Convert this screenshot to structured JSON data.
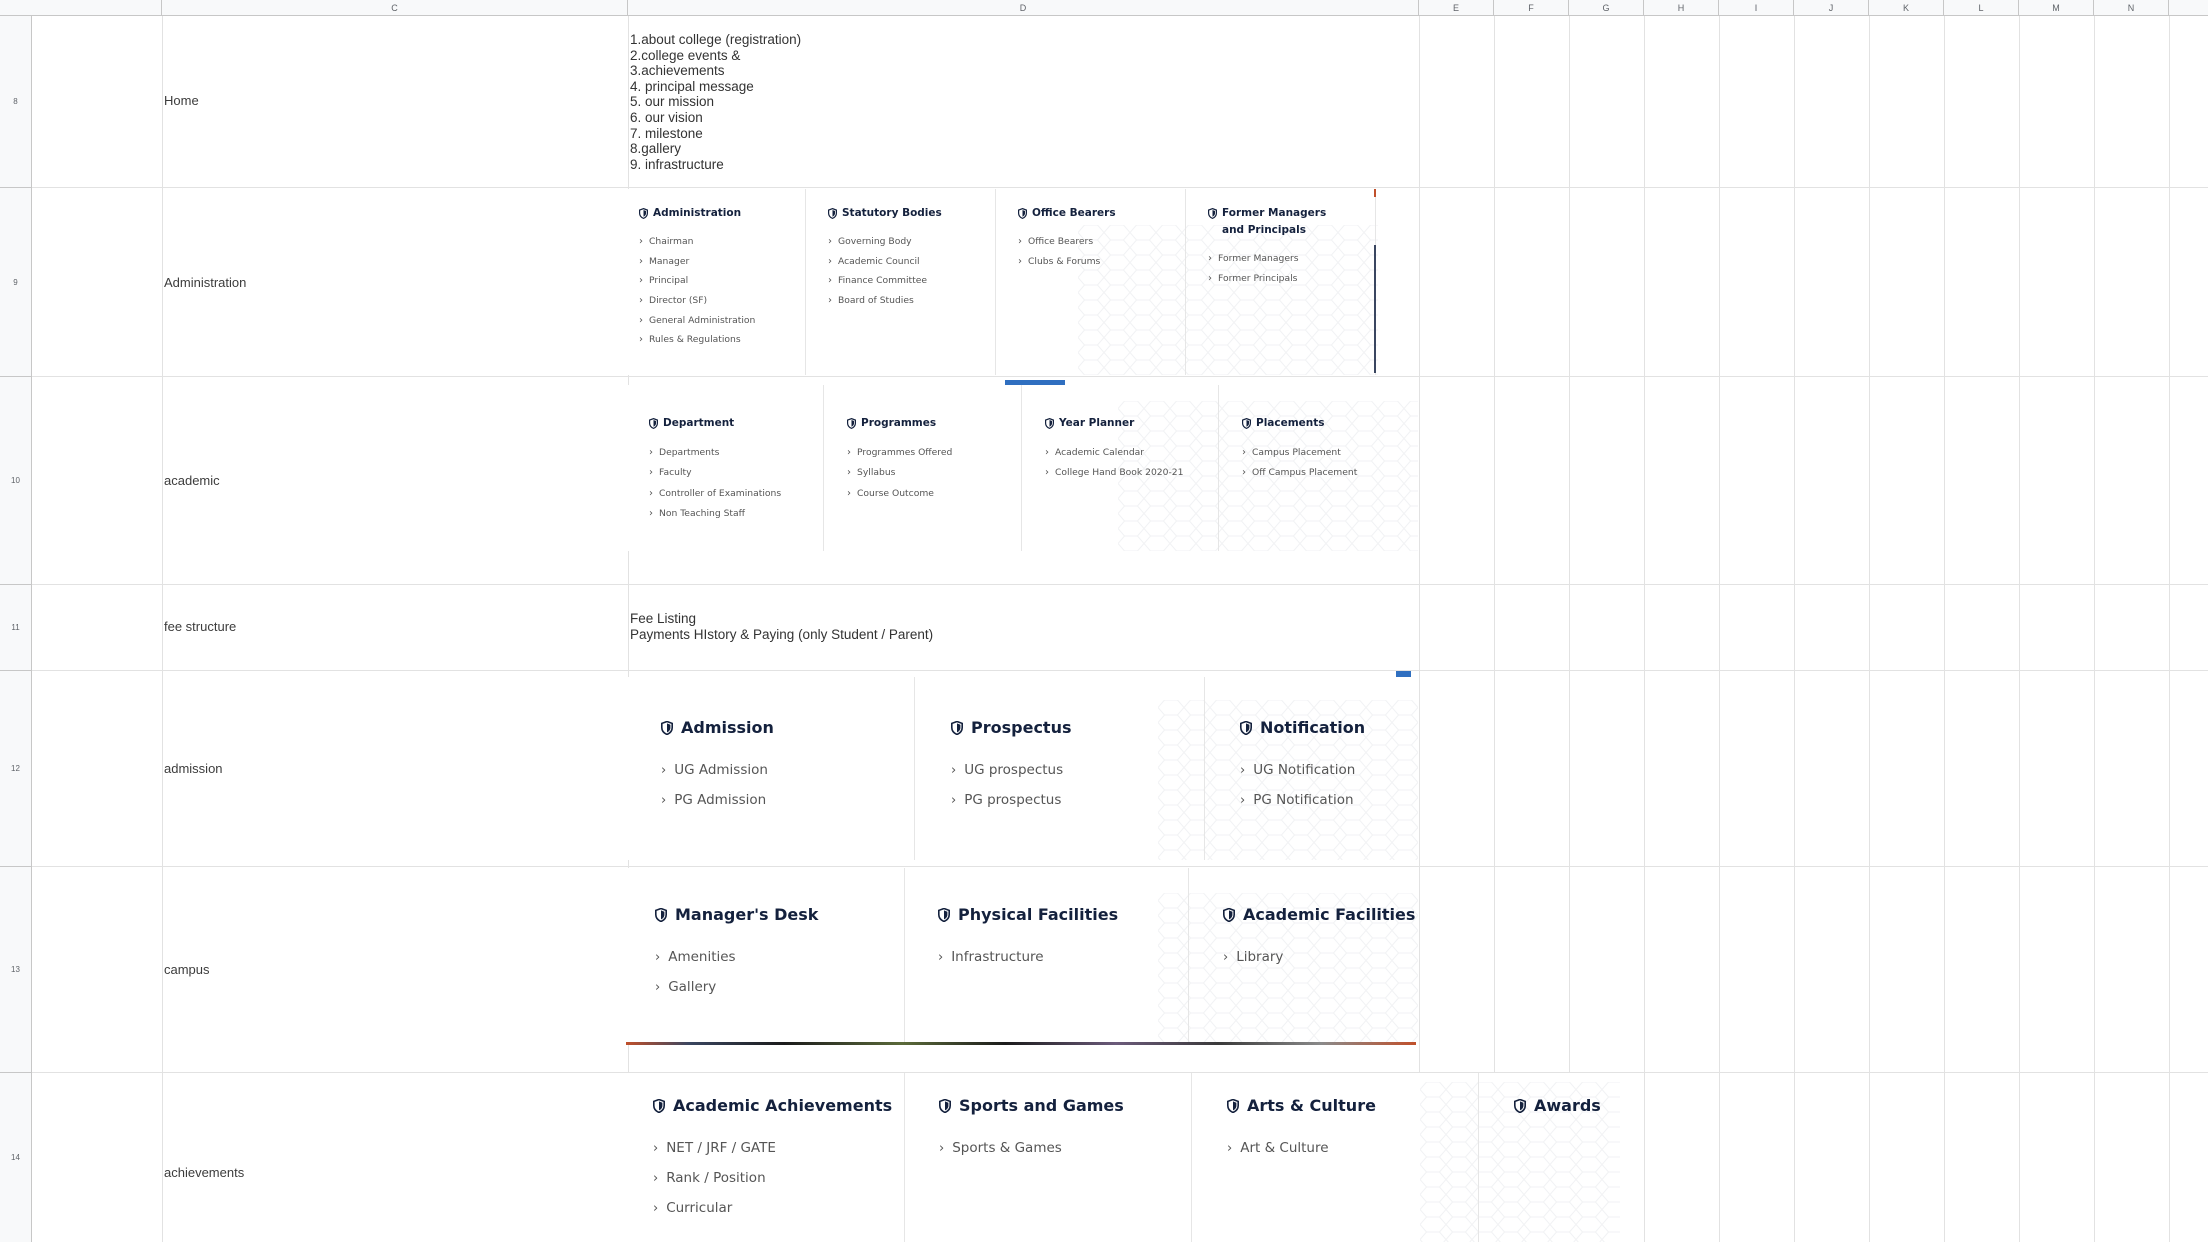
{
  "sheet": {
    "column_headers": [
      "C",
      "D",
      "E",
      "F",
      "G",
      "H",
      "I",
      "J",
      "K",
      "L",
      "M",
      "N"
    ],
    "row_numbers": [
      "8",
      "9",
      "10",
      "11",
      "12",
      "13",
      "14"
    ]
  },
  "rows": {
    "r8": {
      "label": "Home"
    },
    "r9": {
      "label": "Administration"
    },
    "r10": {
      "label": "academic"
    },
    "r11": {
      "label": "fee structure"
    },
    "r12": {
      "label": "admission"
    },
    "r13": {
      "label": "campus"
    },
    "r14": {
      "label": " achievements"
    }
  },
  "home_list": [
    "1.about college (registration)",
    "2.college events &",
    "3.achievements",
    "4. principal message",
    "5. our mission",
    "6. our vision",
    "7. milestone",
    "8.gallery",
    "9. infrastructure"
  ],
  "fee_list": [
    "Fee Listing",
    "Payments HIstory & Paying (only Student / Parent)"
  ],
  "admin_menu": [
    {
      "title": "Administration",
      "items": [
        "Chairman",
        "Manager",
        "Principal",
        "Director (SF)",
        "General Administration",
        "Rules & Regulations"
      ]
    },
    {
      "title": "Statutory Bodies",
      "items": [
        "Governing Body",
        "Academic Council",
        "Finance Committee",
        "Board of Studies"
      ]
    },
    {
      "title": "Office Bearers",
      "items": [
        "Office Bearers",
        "Clubs & Forums"
      ]
    },
    {
      "title": "Former Managers and Principals",
      "items": [
        "Former Managers",
        "Former Principals"
      ]
    }
  ],
  "academic_menu": [
    {
      "title": "Department",
      "items": [
        "Departments",
        "Faculty",
        "Controller of Examinations",
        "Non Teaching Staff"
      ]
    },
    {
      "title": "Programmes",
      "items": [
        "Programmes Offered",
        "Syllabus",
        "Course Outcome"
      ]
    },
    {
      "title": "Year Planner",
      "items": [
        "Academic Calendar",
        "College Hand Book 2020-21"
      ]
    },
    {
      "title": "Placements",
      "items": [
        "Campus Placement",
        "Off Campus Placement"
      ]
    }
  ],
  "admission_menu": [
    {
      "title": "Admission",
      "items": [
        "UG Admission",
        "PG Admission"
      ]
    },
    {
      "title": "Prospectus",
      "items": [
        "UG prospectus",
        "PG prospectus"
      ]
    },
    {
      "title": "Notification",
      "items": [
        "UG Notification",
        "PG Notification"
      ]
    }
  ],
  "campus_menu": [
    {
      "title": "Manager's Desk",
      "items": [
        "Amenities",
        "Gallery"
      ]
    },
    {
      "title": "Physical Facilities",
      "items": [
        "Infrastructure"
      ]
    },
    {
      "title": "Academic Facilities",
      "items": [
        "Library"
      ]
    }
  ],
  "achievements_menu": [
    {
      "title": "Academic Achievements",
      "items": [
        "NET / JRF / GATE",
        "Rank / Position",
        "Curricular"
      ]
    },
    {
      "title": "Sports and Games",
      "items": [
        "Sports & Games"
      ]
    },
    {
      "title": "Arts & Culture",
      "items": [
        "Art & Culture"
      ]
    },
    {
      "title": "Awards",
      "items": []
    }
  ],
  "colors": {
    "heading": "#14213d",
    "item": "#555555",
    "accent_blue": "#2f6fc0",
    "grid_line": "#e2e2e2",
    "header_bg": "#f8f9fa"
  }
}
